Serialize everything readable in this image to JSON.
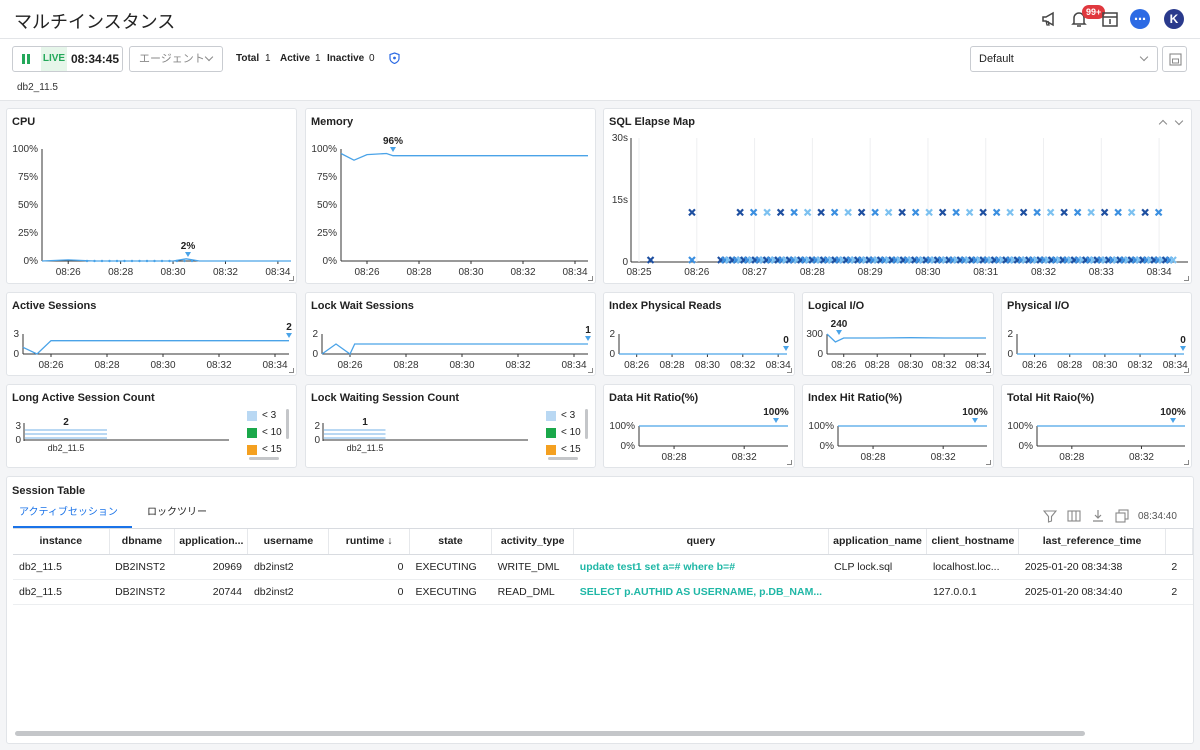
{
  "header": {
    "title": "マルチインスタンス",
    "notification_badge": "99+",
    "avatar_letter": "K"
  },
  "toolbar": {
    "live_label": "LIVE",
    "time": "08:34:45",
    "agent_placeholder": "エージェント",
    "total_label": "Total",
    "total_value": "1",
    "active_label": "Active",
    "active_value": "1",
    "inactive_label": "Inactive",
    "inactive_value": "0",
    "preset": "Default"
  },
  "instance_tag": "db2_11.5",
  "panels": {
    "cpu": {
      "title": "CPU",
      "yticks": [
        "100%",
        "75%",
        "50%",
        "25%",
        "0%"
      ],
      "xticks": [
        "08:26",
        "08:28",
        "08:30",
        "08:32",
        "08:34"
      ],
      "peak_label": "2%"
    },
    "memory": {
      "title": "Memory",
      "yticks": [
        "100%",
        "75%",
        "50%",
        "25%",
        "0%"
      ],
      "xticks": [
        "08:26",
        "08:28",
        "08:30",
        "08:32",
        "08:34"
      ],
      "peak_label": "96%"
    },
    "sql_elapse": {
      "title": "SQL Elapse Map",
      "yticks": [
        "30s",
        "15s",
        "0"
      ],
      "xticks": [
        "08:25",
        "08:26",
        "08:27",
        "08:28",
        "08:29",
        "08:30",
        "08:31",
        "08:32",
        "08:33",
        "08:34"
      ]
    },
    "active_sessions": {
      "title": "Active Sessions",
      "yticks": [
        "3",
        "0"
      ],
      "xticks": [
        "08:26",
        "08:28",
        "08:30",
        "08:32",
        "08:34"
      ],
      "value": "2"
    },
    "lock_wait_sessions": {
      "title": "Lock Wait Sessions",
      "yticks": [
        "2",
        "0"
      ],
      "xticks": [
        "08:26",
        "08:28",
        "08:30",
        "08:32",
        "08:34"
      ],
      "value": "1"
    },
    "index_physical_reads": {
      "title": "Index Physical Reads",
      "yticks": [
        "2",
        "0"
      ],
      "xticks": [
        "08:26",
        "08:28",
        "08:30",
        "08:32",
        "08:34"
      ],
      "value": "0"
    },
    "logical_io": {
      "title": "Logical I/O",
      "yticks": [
        "300",
        "0"
      ],
      "xticks": [
        "08:26",
        "08:28",
        "08:30",
        "08:32",
        "08:34"
      ],
      "value": "240"
    },
    "physical_io": {
      "title": "Physical I/O",
      "yticks": [
        "2",
        "0"
      ],
      "xticks": [
        "08:26",
        "08:28",
        "08:30",
        "08:32",
        "08:34"
      ],
      "value": "0"
    },
    "long_active": {
      "title": "Long Active Session Count",
      "yticks": [
        "3",
        "0"
      ],
      "category": "db2_11.5",
      "value": "2",
      "legend": [
        "< 3",
        "< 10",
        "< 15"
      ]
    },
    "lock_waiting": {
      "title": "Lock Waiting Session Count",
      "yticks": [
        "2",
        "0"
      ],
      "category": "db2_11.5",
      "value": "1",
      "legend": [
        "< 3",
        "< 10",
        "< 15"
      ]
    },
    "data_hit": {
      "title": "Data Hit Ratio(%)",
      "yticks": [
        "100%",
        "0%"
      ],
      "xticks": [
        "08:28",
        "08:32"
      ],
      "value": "100%"
    },
    "index_hit": {
      "title": "Index Hit Ratio(%)",
      "yticks": [
        "100%",
        "0%"
      ],
      "xticks": [
        "08:28",
        "08:32"
      ],
      "value": "100%"
    },
    "total_hit": {
      "title": "Total Hit Raio(%)",
      "yticks": [
        "100%",
        "0%"
      ],
      "xticks": [
        "08:28",
        "08:32"
      ],
      "value": "100%"
    }
  },
  "legend_colors": {
    "lt3": "#b9d8f3",
    "lt10": "#1aa84a",
    "lt15": "#f4a020"
  },
  "session_table": {
    "title": "Session Table",
    "tabs": [
      "アクティブセッション",
      "ロックツリー"
    ],
    "time": "08:34:40",
    "columns": [
      "instance",
      "dbname",
      "application...",
      "username",
      "runtime ↓",
      "state",
      "activity_type",
      "query",
      "application_name",
      "client_hostname",
      "last_reference_time",
      ""
    ],
    "rows": [
      [
        "db2_11.5",
        "DB2INST2",
        "20969",
        "db2inst2",
        "0",
        "EXECUTING",
        "WRITE_DML",
        "update test1 set a=# where b=#",
        "CLP lock.sql",
        "localhost.loc...",
        "2025-01-20 08:34:38",
        "2"
      ],
      [
        "db2_11.5",
        "DB2INST2",
        "20744",
        "db2inst2",
        "0",
        "EXECUTING",
        "READ_DML",
        "SELECT p.AUTHID AS USERNAME, p.DB_NAM...",
        "",
        "127.0.0.1",
        "2025-01-20 08:34:40",
        "2"
      ]
    ]
  },
  "chart_data": [
    {
      "type": "line",
      "title": "CPU",
      "x": [
        "08:25",
        "08:26",
        "08:27",
        "08:28",
        "08:29",
        "08:30",
        "08:30:30",
        "08:31",
        "08:32",
        "08:33",
        "08:34"
      ],
      "values": [
        0,
        1,
        0,
        0,
        0,
        0,
        2,
        0,
        0,
        0,
        0
      ],
      "ylim": [
        0,
        100
      ]
    },
    {
      "type": "line",
      "title": "Memory",
      "x": [
        "08:25",
        "08:25:30",
        "08:26",
        "08:26:45",
        "08:27",
        "08:28",
        "08:30",
        "08:32",
        "08:34"
      ],
      "values": [
        96,
        90,
        95,
        96,
        94,
        94,
        94,
        94,
        94
      ],
      "ylim": [
        0,
        100
      ]
    },
    {
      "type": "line",
      "title": "Active Sessions",
      "x": [
        "08:25",
        "08:25:30",
        "08:26",
        "08:28",
        "08:30",
        "08:32",
        "08:34"
      ],
      "values": [
        1,
        0,
        2,
        2,
        2,
        2,
        2
      ],
      "ylim": [
        0,
        3
      ]
    },
    {
      "type": "line",
      "title": "Lock Wait Sessions",
      "x": [
        "08:25",
        "08:25:30",
        "08:26",
        "08:26:10",
        "08:28",
        "08:30",
        "08:32",
        "08:34"
      ],
      "values": [
        0,
        1,
        0,
        1,
        1,
        1,
        1,
        1
      ],
      "ylim": [
        0,
        2
      ]
    },
    {
      "type": "line",
      "title": "Index Physical Reads",
      "x": [
        "08:25",
        "08:34"
      ],
      "values": [
        0,
        0
      ],
      "ylim": [
        0,
        2
      ]
    },
    {
      "type": "line",
      "title": "Logical I/O",
      "x": [
        "08:25",
        "08:25:30",
        "08:26",
        "08:28",
        "08:30",
        "08:32",
        "08:34"
      ],
      "values": [
        300,
        180,
        240,
        240,
        245,
        240,
        240
      ],
      "ylim": [
        0,
        300
      ]
    },
    {
      "type": "line",
      "title": "Physical I/O",
      "x": [
        "08:25",
        "08:34"
      ],
      "values": [
        0,
        0
      ],
      "ylim": [
        0,
        2
      ]
    },
    {
      "type": "bar",
      "title": "Long Active Session Count",
      "categories": [
        "db2_11.5"
      ],
      "values": [
        2
      ],
      "ylim": [
        0,
        3
      ]
    },
    {
      "type": "bar",
      "title": "Lock Waiting Session Count",
      "categories": [
        "db2_11.5"
      ],
      "values": [
        1
      ],
      "ylim": [
        0,
        2
      ]
    },
    {
      "type": "line",
      "title": "Data Hit Ratio(%)",
      "x": [
        "08:26",
        "08:34"
      ],
      "values": [
        100,
        100
      ],
      "ylim": [
        0,
        100
      ]
    },
    {
      "type": "line",
      "title": "Index Hit Ratio(%)",
      "x": [
        "08:26",
        "08:34"
      ],
      "values": [
        100,
        100
      ],
      "ylim": [
        0,
        100
      ]
    },
    {
      "type": "line",
      "title": "Total Hit Raio(%)",
      "x": [
        "08:26",
        "08:34"
      ],
      "values": [
        100,
        100
      ],
      "ylim": [
        0,
        100
      ]
    },
    {
      "type": "scatter",
      "title": "SQL Elapse Map",
      "x_range": [
        "08:25",
        "08:34:30"
      ],
      "ylim": [
        0,
        30
      ],
      "series": [
        {
          "values": [
            0,
            0,
            0
          ]
        },
        {
          "values": [
            12,
            12,
            12
          ]
        }
      ]
    }
  ]
}
